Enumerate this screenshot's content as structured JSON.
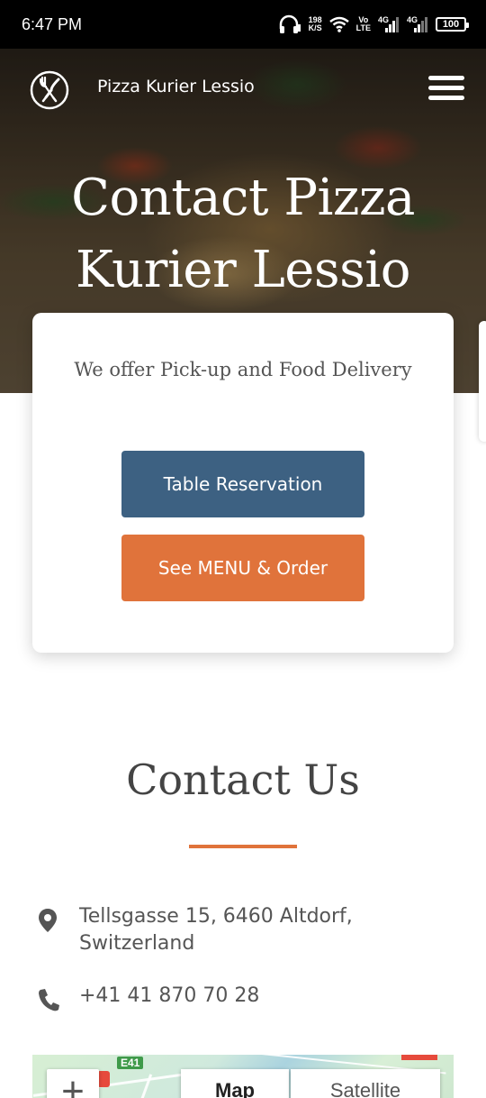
{
  "status_bar": {
    "time": "6:47 PM",
    "speed_value": "198",
    "speed_unit": "K/S",
    "volte_top": "Vo",
    "volte_bottom": "LTE",
    "signal1_label": "4G",
    "signal2_label": "4G",
    "battery": "100"
  },
  "header": {
    "brand": "Pizza Kurier Lessio",
    "logo_icon": "fork-knife-icon",
    "menu_icon": "hamburger-menu-icon"
  },
  "hero": {
    "title_line1": "Contact Pizza",
    "title_line2": "Kurier Lessio"
  },
  "card": {
    "subtitle": "We offer Pick-up and Food Delivery",
    "reserve_label": "Table Reservation",
    "menu_label": "See MENU & Order"
  },
  "contact": {
    "title": "Contact Us",
    "address": "Tellsgasse 15, 6460 Altdorf, Switzerland",
    "phone": "+41 41 870 70 28"
  },
  "map": {
    "road_badge": "E41",
    "zoom_in": "+",
    "type_map": "Map",
    "type_satellite": "Satellite"
  },
  "colors": {
    "primary_blue": "#3d6182",
    "accent_orange": "#e0733b",
    "text_gray": "#555555"
  }
}
